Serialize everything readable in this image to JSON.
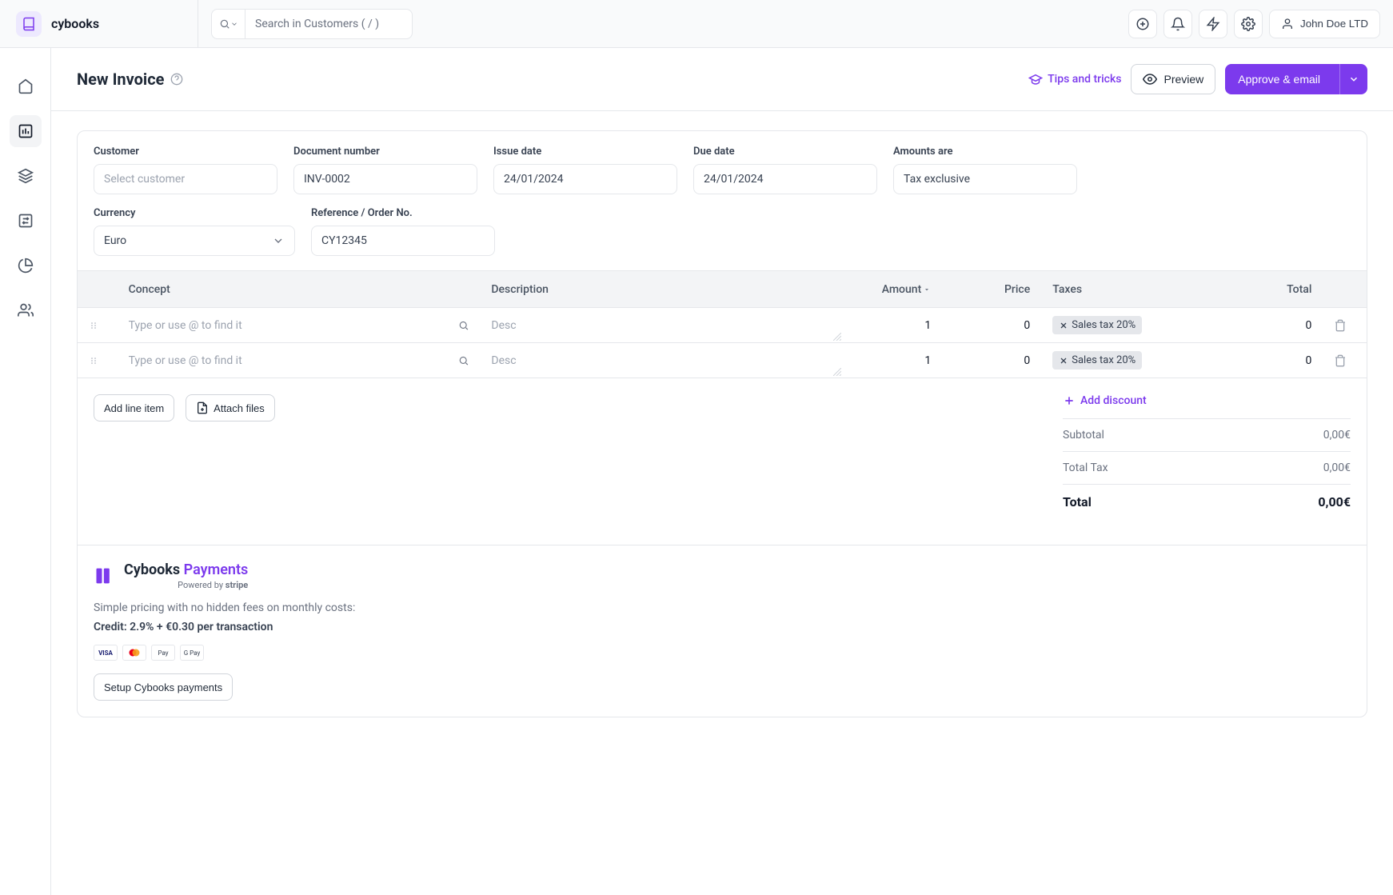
{
  "brand": {
    "name": "cybooks"
  },
  "search": {
    "placeholder": "Search in Customers ( / )"
  },
  "user": {
    "label": "John Doe LTD"
  },
  "page": {
    "title": "New Invoice",
    "tips": "Tips and tricks",
    "preview": "Preview",
    "approve": "Approve & email"
  },
  "form": {
    "customer_label": "Customer",
    "customer_placeholder": "Select customer",
    "customer_value": "",
    "docnum_label": "Document number",
    "docnum_value": "INV-0002",
    "issue_label": "Issue date",
    "issue_value": "24/01/2024",
    "due_label": "Due date",
    "due_value": "24/01/2024",
    "amounts_label": "Amounts are",
    "amounts_value": "Tax exclusive",
    "currency_label": "Currency",
    "currency_value": "Euro",
    "ref_label": "Reference / Order No.",
    "ref_value": "CY12345"
  },
  "table": {
    "head": {
      "concept": "Concept",
      "description": "Description",
      "amount": "Amount",
      "price": "Price",
      "taxes": "Taxes",
      "total": "Total"
    },
    "concept_placeholder": "Type or use @ to find it",
    "desc_placeholder": "Desc",
    "rows": [
      {
        "amount": "1",
        "price": "0",
        "tax": "Sales tax 20%",
        "total": "0"
      },
      {
        "amount": "1",
        "price": "0",
        "tax": "Sales tax 20%",
        "total": "0"
      }
    ]
  },
  "actions": {
    "add_line": "Add line item",
    "attach": "Attach files",
    "add_discount": "Add discount"
  },
  "summary": {
    "subtotal_label": "Subtotal",
    "subtotal_value": "0,00€",
    "tax_label": "Total Tax",
    "tax_value": "0,00€",
    "total_label": "Total",
    "total_value": "0,00€"
  },
  "payments": {
    "title_a": "Cybooks",
    "title_b": "Payments",
    "powered_by": "Powered by",
    "stripe": "stripe",
    "desc": "Simple pricing with no hidden fees on monthly costs:",
    "credit": "Credit: 2.9% + €0.30 per transaction",
    "badges": [
      "VISA",
      "MC",
      "Pay",
      "G Pay"
    ],
    "setup": "Setup Cybooks payments"
  }
}
